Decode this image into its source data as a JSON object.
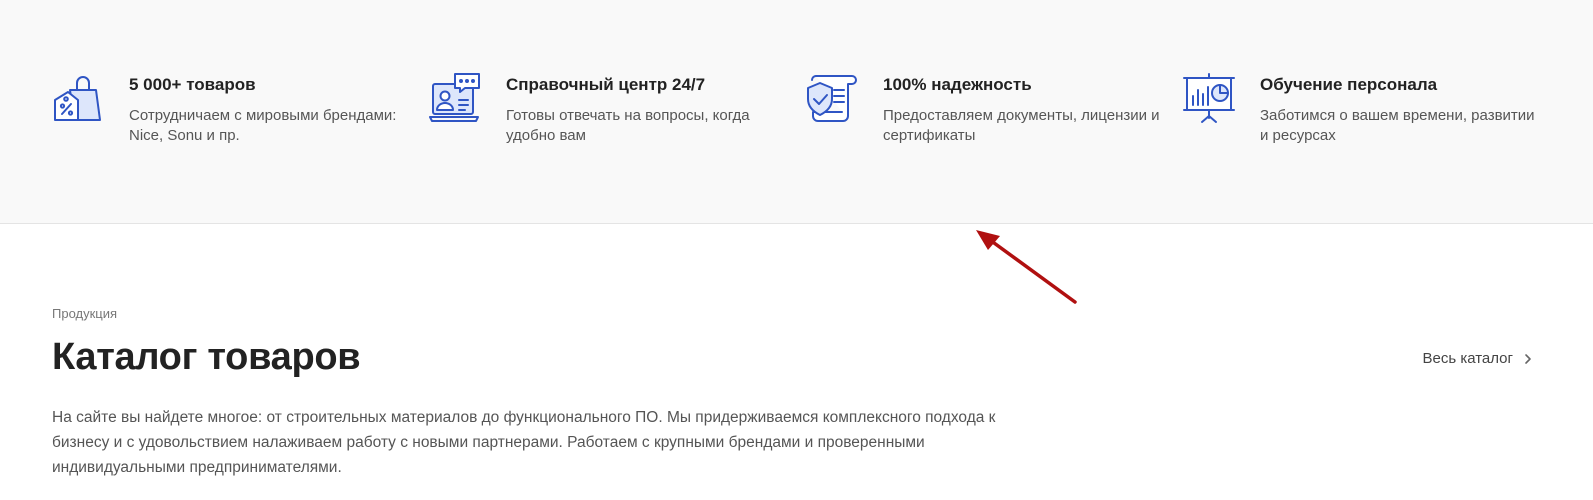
{
  "features": [
    {
      "icon": "shopping-bag-icon",
      "title": "5 000+ товаров",
      "description": "Сотрудничаем с мировыми брендами: Nice, Sonu и пр."
    },
    {
      "icon": "support-chat-icon",
      "title": "Справочный центр 24/7",
      "description": "Готовы отвечать на вопросы, когда удобно вам"
    },
    {
      "icon": "shield-document-icon",
      "title": "100% надежность",
      "description": "Предоставляем документы, лицензии и сертификаты"
    },
    {
      "icon": "presentation-board-icon",
      "title": "Обучение персонала",
      "description": "Заботимся о вашем времени, развитии и ресурсах"
    }
  ],
  "catalog": {
    "eyebrow": "Продукция",
    "title": "Каталог товаров",
    "all_link": "Весь каталог",
    "description": "На сайте вы найдете многое: от строительных материалов до функционального ПО. Мы придерживаемся комплексного подхода к бизнесу и с удовольствием налаживаем работу с новыми партнерами. Работаем с крупными брендами и проверенными индивидуальными предпринимателями."
  },
  "colors": {
    "band_background": "#f9f9f9",
    "icon_primary": "#2f55c4",
    "icon_fill": "#dde6fb",
    "annotation_arrow": "#b01010"
  }
}
